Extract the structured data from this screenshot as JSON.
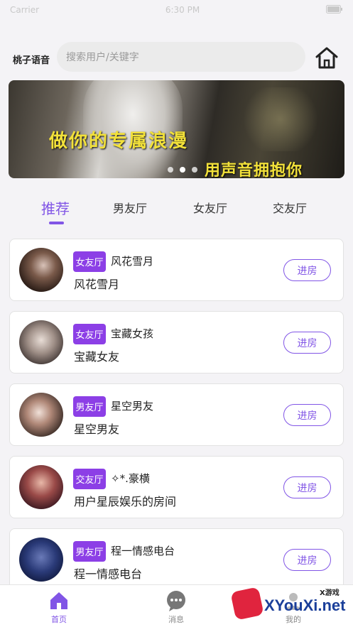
{
  "status_bar": {
    "carrier": "Carrier",
    "time": "6:30 PM"
  },
  "header": {
    "app_name": "桃子语音",
    "search_placeholder": "搜索用户/关键字"
  },
  "banner": {
    "line1": "做你的专属浪漫",
    "line2": "用声音拥抱你",
    "slide_count": 3,
    "active_slide": 0
  },
  "tabs": [
    {
      "label": "推荐",
      "active": true
    },
    {
      "label": "男友厅",
      "active": false
    },
    {
      "label": "女友厅",
      "active": false
    },
    {
      "label": "交友厅",
      "active": false
    }
  ],
  "rooms": [
    {
      "badge": "女友厅",
      "name": "风花雪月",
      "subtitle": "风花雪月",
      "button": "进房",
      "avatar_color": "#3a2a22"
    },
    {
      "badge": "女友厅",
      "name": "宝藏女孩",
      "subtitle": "宝藏女友",
      "button": "进房",
      "avatar_color": "#6a5a55"
    },
    {
      "badge": "男友厅",
      "name": "星空男友",
      "subtitle": "星空男友",
      "button": "进房",
      "avatar_color": "#4a3630"
    },
    {
      "badge": "交友厅",
      "name": "✧*.豪横",
      "subtitle": "用户星辰娱乐的房间",
      "button": "进房",
      "avatar_color": "#5a2a30"
    },
    {
      "badge": "男友厅",
      "name": "程一情感电台",
      "subtitle": "程一情感电台",
      "button": "进房",
      "avatar_color": "#1e2a5a"
    }
  ],
  "bottom_nav": [
    {
      "label": "首页",
      "icon": "home-icon",
      "active": true
    },
    {
      "label": "消息",
      "icon": "chat-bubble-icon",
      "active": false
    },
    {
      "label": "我的",
      "icon": "profile-icon",
      "active": false
    }
  ],
  "watermark": {
    "text": "XYouXi.net",
    "small": "X游戏"
  },
  "colors": {
    "accent": "#8155e6",
    "badge": "#8c3fe6"
  }
}
